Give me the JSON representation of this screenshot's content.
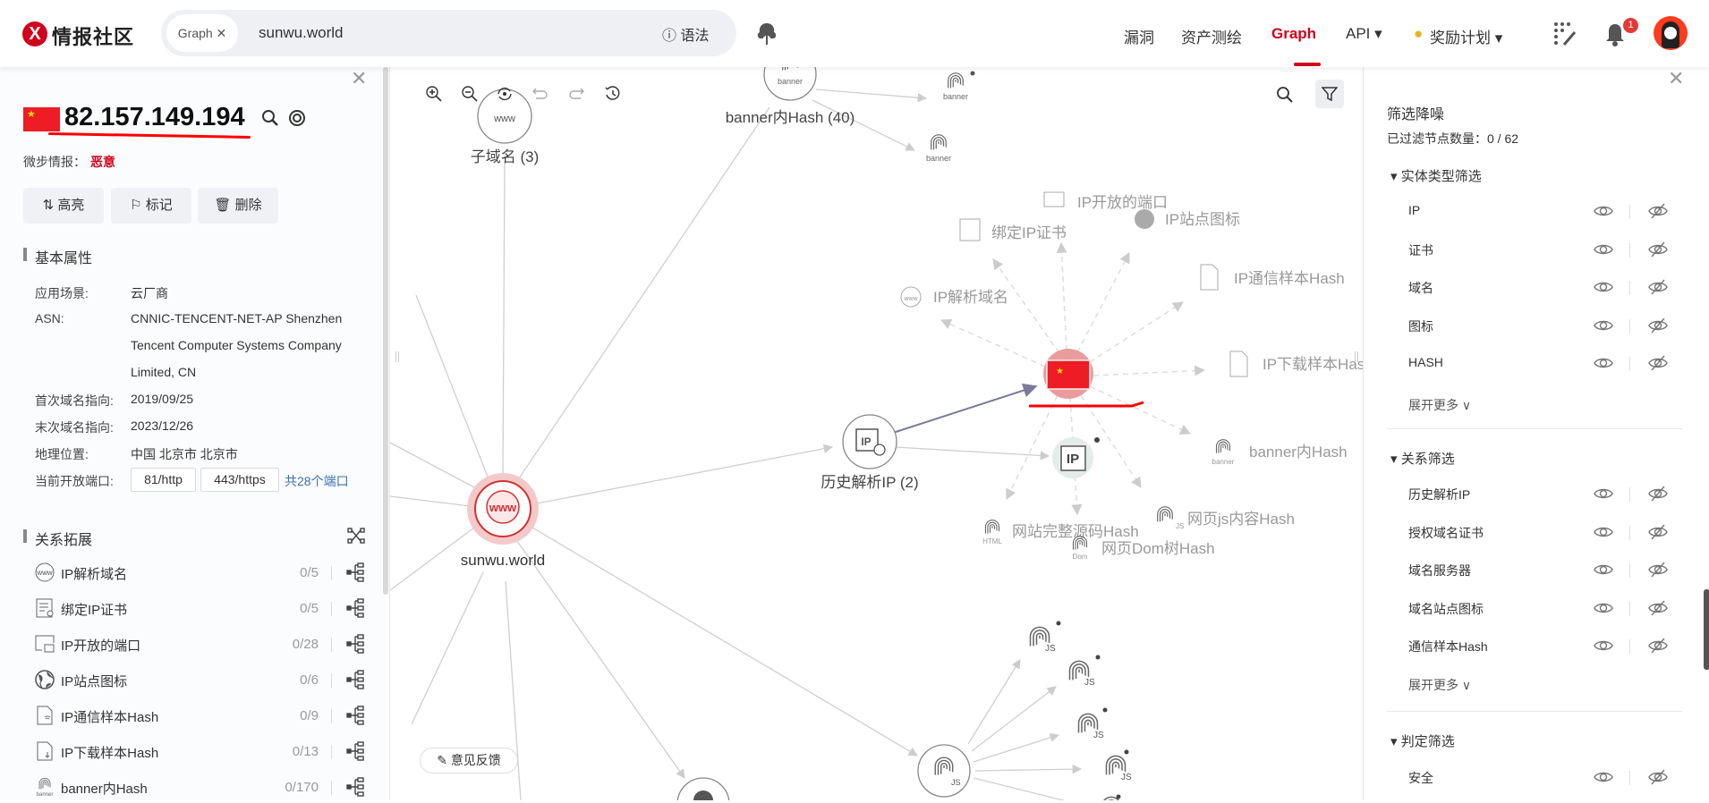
{
  "header": {
    "logo_text": "情报社区",
    "search": {
      "chip": "Graph ✕",
      "query": "sunwu.world",
      "syntax": "语法"
    },
    "nav": [
      "漏洞",
      "资产测绘",
      "Graph",
      "API ▾",
      "奖励计划 ▾"
    ],
    "active_nav": "Graph",
    "notification_count": "1",
    "accent": "#d0021b"
  },
  "left_panel": {
    "ip": "82.157.149.194",
    "verdict_label": "微步情报：",
    "verdict": "恶意",
    "actions": [
      "高亮",
      "标记",
      "删除"
    ],
    "basic_title": "基本属性",
    "props": [
      {
        "label": "应用场景:",
        "value": "云厂商"
      },
      {
        "label": "ASN:",
        "value": "CNNIC-TENCENT-NET-AP Shenzhen",
        "value2": "Tencent Computer Systems Company",
        "value3": "Limited, CN"
      },
      {
        "label": "首次域名指向:",
        "value": "2019/09/25"
      },
      {
        "label": "末次域名指向:",
        "value": "2023/12/26"
      },
      {
        "label": "地理位置:",
        "value": "中国 北京市 北京市"
      },
      {
        "label": "当前开放端口:",
        "ports": [
          "81/http",
          "443/https"
        ],
        "more": "共28个端口"
      }
    ],
    "relations_title": "关系拓展",
    "relations": [
      {
        "label": "IP解析域名",
        "count": "0/5",
        "icon": "www-icon"
      },
      {
        "label": "绑定IP证书",
        "count": "0/5",
        "icon": "certificate-icon"
      },
      {
        "label": "IP开放的端口",
        "count": "0/28",
        "icon": "port-icon"
      },
      {
        "label": "IP站点图标",
        "count": "0/6",
        "icon": "globe-icon"
      },
      {
        "label": "IP通信样本Hash",
        "count": "0/9",
        "icon": "file-signal-icon"
      },
      {
        "label": "IP下载样本Hash",
        "count": "0/13",
        "icon": "file-download-icon"
      },
      {
        "label": "banner内Hash",
        "count": "0/170",
        "icon": "fingerprint-banner-icon"
      }
    ]
  },
  "graph": {
    "nodes": {
      "main": "sunwu.world",
      "subdomain": "子域名 (3)",
      "banner_hash": "banner内Hash (40)",
      "history_ip": "历史解析IP (2)"
    },
    "satellites": [
      "IP开放的端口",
      "绑定IP证书",
      "IP站点图标",
      "IP通信样本Hash",
      "IP解析域名",
      "IP下载样本Hash",
      "banner内Hash",
      "网页js内容Hash",
      "网站完整源码Hash",
      "网页Dom树Hash"
    ],
    "icon_text": {
      "www": "www",
      "banner": "banner",
      "js": "JS",
      "html": "HTML",
      "dom": "Dom",
      "ip": "IP"
    },
    "feedback": "意见反馈"
  },
  "right_panel": {
    "title": "筛选降噪",
    "filtered": "已过滤节点数量：0 / 62",
    "groups": [
      {
        "title": "实体类型筛选",
        "items": [
          "IP",
          "证书",
          "域名",
          "图标",
          "HASH"
        ],
        "more": "展开更多 ∨"
      },
      {
        "title": "关系筛选",
        "items": [
          "历史解析IP",
          "授权域名证书",
          "域名服务器",
          "域名站点图标",
          "通信样本Hash"
        ],
        "more": "展开更多 ∨"
      },
      {
        "title": "判定筛选",
        "items": [
          "安全"
        ]
      }
    ]
  }
}
